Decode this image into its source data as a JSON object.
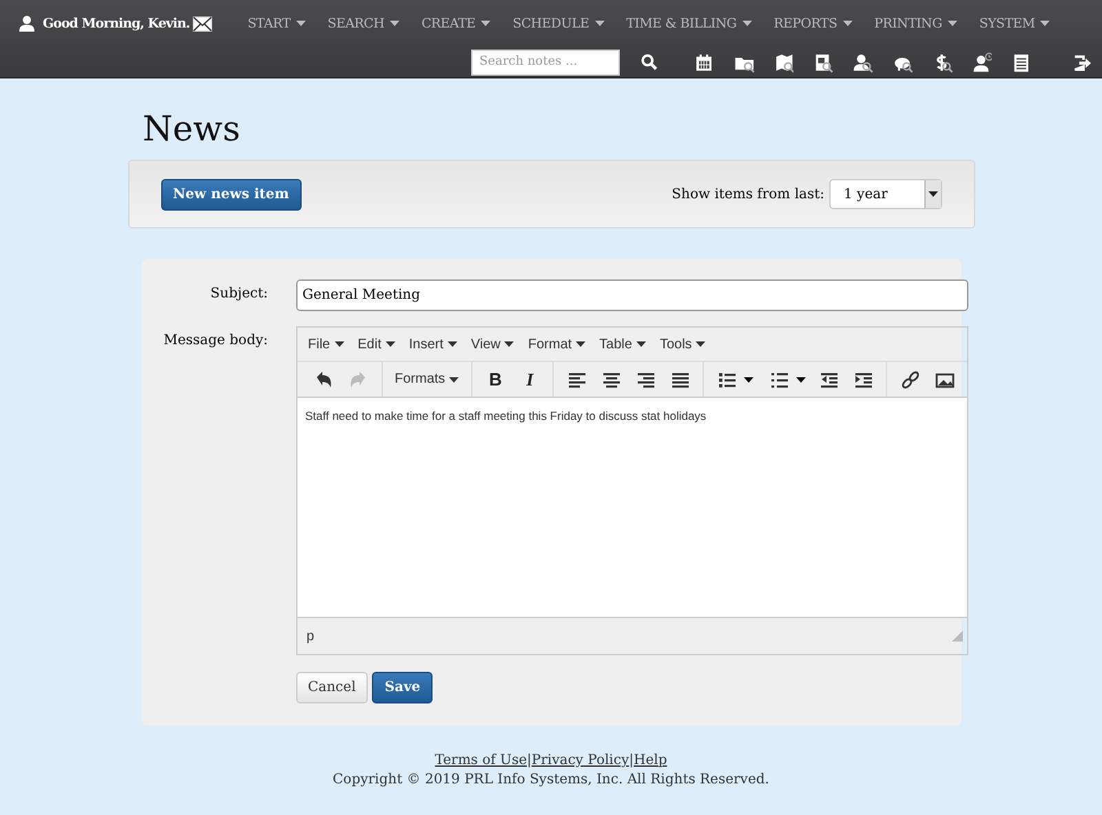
{
  "navbar": {
    "greeting": "Good Morning, Kevin.",
    "menus": [
      {
        "label": "START"
      },
      {
        "label": "SEARCH"
      },
      {
        "label": "CREATE"
      },
      {
        "label": "SCHEDULE"
      },
      {
        "label": "TIME & BILLING"
      },
      {
        "label": "REPORTS"
      },
      {
        "label": "PRINTING"
      },
      {
        "label": "SYSTEM"
      }
    ],
    "search": {
      "placeholder": "Search notes ..."
    }
  },
  "page": {
    "title": "News"
  },
  "toolbar": {
    "new_button": "New news item",
    "filter_label": "Show items from last:",
    "filter_value": "1 year"
  },
  "form": {
    "subject_label": "Subject:",
    "subject_value": "General Meeting",
    "body_label": "Message body:",
    "editor": {
      "menus": [
        "File",
        "Edit",
        "Insert",
        "View",
        "Format",
        "Table",
        "Tools"
      ],
      "formats": "Formats",
      "bold": "B",
      "italic": "I",
      "redo_disabled": true,
      "content": "Staff need to make time for a staff meeting this Friday to discuss stat holidays",
      "path": "p"
    },
    "buttons": [
      {
        "label": "Cancel",
        "kind": "default"
      },
      {
        "label": "Save",
        "kind": "primary"
      }
    ]
  },
  "footer": {
    "links": [
      "Terms of Use",
      "Privacy Policy",
      "Help"
    ],
    "separator": "|",
    "copyright": "Copyright © 2019 PRL Info Systems, Inc. All Rights Reserved."
  }
}
